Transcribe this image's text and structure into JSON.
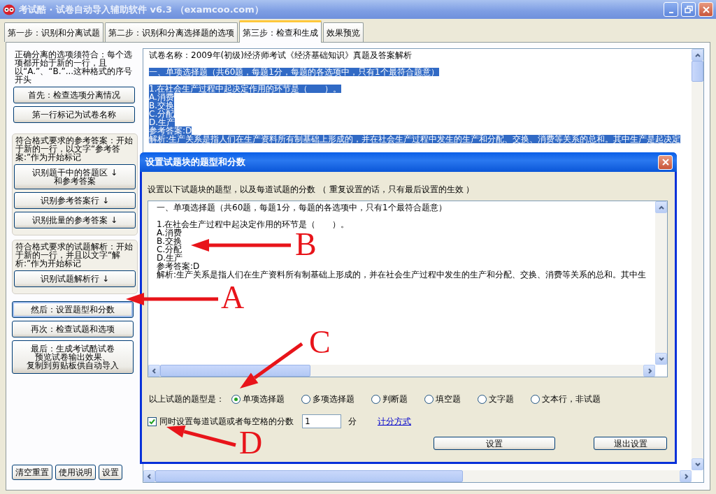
{
  "window": {
    "title": "考试酷 · 试卷自动导入辅助软件 v6.3 （examcoo.com）"
  },
  "tabs": [
    {
      "label": "第一步：识别和分离试题",
      "selected": false
    },
    {
      "label": "第二步：识别和分离选择题的选项",
      "selected": false
    },
    {
      "label": "第三步：检查和生成",
      "selected": true
    },
    {
      "label": "效果预览",
      "selected": false
    }
  ],
  "sidebar": {
    "groups": [
      {
        "framed": false,
        "note": "正确分离的选项须符合：每个选项都开始于新的一行，且以“A.”、“B.”...这种格式的序号开头",
        "buttons": [
          {
            "label": "首先：检查选项分离情况",
            "focused": false
          },
          {
            "label": "第一行标记为试卷名称",
            "focused": false
          }
        ]
      },
      {
        "framed": true,
        "note": "符合格式要求的参考答案：开始于新的一行，以文字“参考答案:”作为开始标记",
        "buttons": [
          {
            "lines": [
              "识别题干中的答题区 ↓",
              "和参考答案"
            ],
            "focused": false
          },
          {
            "label": "识别参考答案行 ↓",
            "focused": false
          },
          {
            "label": "识别批量的参考答案 ↓",
            "focused": false
          }
        ]
      },
      {
        "framed": true,
        "note": "符合格式要求的试题解析：开始于新的一行，并且以文字“解析:”作为开始标记",
        "buttons": [
          {
            "label": "识别试题解析行 ↓",
            "focused": false
          }
        ]
      }
    ],
    "steps": [
      {
        "label": "然后：设置题型和分数",
        "focused": true
      },
      {
        "label": "再次：检查试题和选项",
        "focused": false
      },
      {
        "lines": [
          "最后：生成考试酷试卷",
          "预览试卷输出效果、",
          "复制到剪贴板供自动导入"
        ],
        "focused": false
      }
    ],
    "footer_buttons": [
      "清空重置",
      "使用说明",
      "设置"
    ]
  },
  "document": {
    "lines": [
      {
        "text": "试卷名称：2009年(初级)经济师考试《经济基础知识》真题及答案解析",
        "selected": false
      },
      {
        "text": "一、单项选择题（共60题，每题1分，每题的各选项中，只有1个最符合题意）",
        "selected": true,
        "spaced": true
      },
      {
        "text": "1.在社会生产过程中起决定作用的环节是（　　）。",
        "selected": true,
        "spaced": true
      },
      {
        "text": "A.消费",
        "selected": true
      },
      {
        "text": "B.交换",
        "selected": true
      },
      {
        "text": "C.分配",
        "selected": true
      },
      {
        "text": "D.生产",
        "selected": true
      },
      {
        "text": "参考答案:D",
        "selected": true
      },
      {
        "text": "解析:生产关系是指人们在生产资料所有制基础上形成的，并在社会生产过程中发生的生产和分配、交换、消费等关系的总和。其中生产是起决定",
        "selected": true
      }
    ]
  },
  "dialog": {
    "title": "设置试题块的题型和分数",
    "description": "设置以下试题块的题型，以及每道试题的分数 （ 重复设置的话，只有最后设置的生效 ）",
    "lines": [
      {
        "text": "一、单项选择题（共60题，每题1分，每题的各选项中，只有1个最符合题意）"
      },
      {
        "text": "1.在社会生产过程中起决定作用的环节是（　　）。",
        "spaced": true
      },
      {
        "text": "A.消费"
      },
      {
        "text": "B.交换"
      },
      {
        "text": "C.分配"
      },
      {
        "text": "D.生产"
      },
      {
        "text": "参考答案:D"
      },
      {
        "text": "解析:生产关系是指人们在生产资料所有制基础上形成的，并在社会生产过程中发生的生产和分配、交换、消费等关系的总和。其中生"
      }
    ],
    "type_label": "以上试题的题型是：",
    "types": [
      {
        "label": "单项选择题",
        "selected": true
      },
      {
        "label": "多项选择题",
        "selected": false
      },
      {
        "label": "判断题",
        "selected": false
      },
      {
        "label": "填空题",
        "selected": false
      },
      {
        "label": "文字题",
        "selected": false
      },
      {
        "label": "文本行，非试题",
        "selected": false
      }
    ],
    "score_checkbox": {
      "label": "同时设置每道试题或者每空格的分数",
      "checked": true
    },
    "score": {
      "value": "1",
      "unit": "分"
    },
    "link": "计分方式",
    "buttons": [
      "设置",
      "退出设置"
    ]
  },
  "annotations": [
    {
      "label": "A"
    },
    {
      "label": "B"
    },
    {
      "label": "C"
    },
    {
      "label": "D"
    }
  ]
}
